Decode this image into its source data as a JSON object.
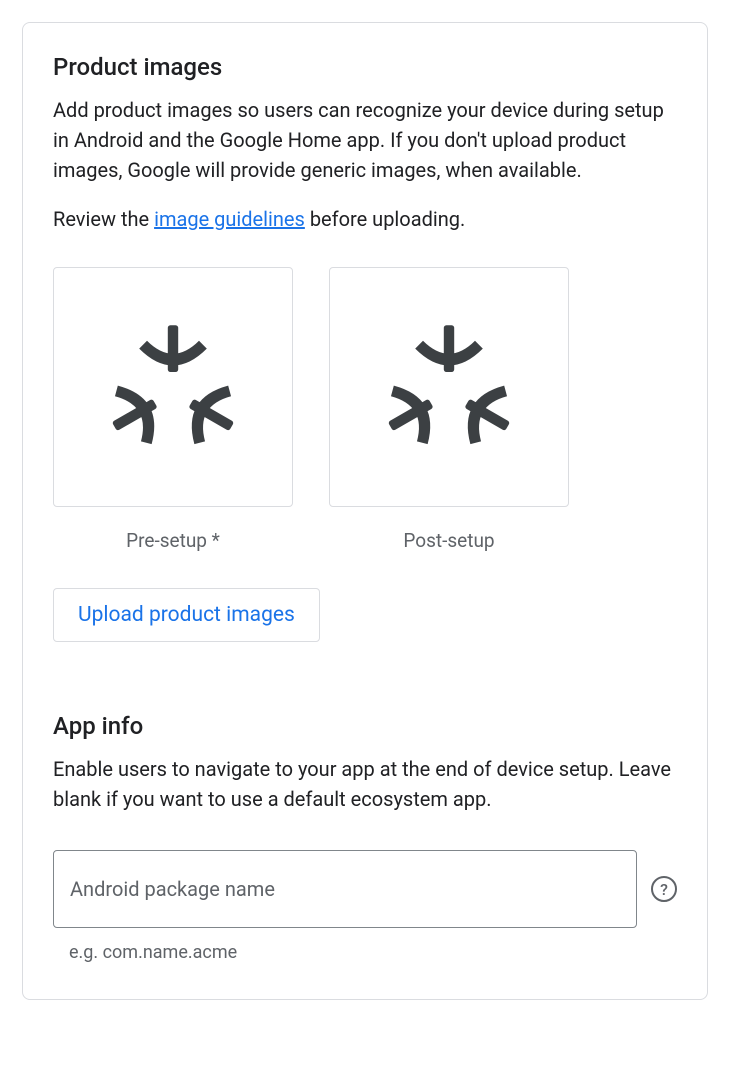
{
  "productImages": {
    "title": "Product images",
    "description": "Add product images so users can recognize your device during setup in Android and the Google Home app. If you don't upload product images, Google will provide generic images, when available.",
    "reviewPrefix": "Review the ",
    "reviewLink": "image guidelines",
    "reviewSuffix": " before uploading.",
    "items": [
      {
        "caption": "Pre-setup *"
      },
      {
        "caption": "Post-setup"
      }
    ],
    "uploadButton": "Upload product images"
  },
  "appInfo": {
    "title": "App info",
    "description": "Enable users to navigate to your app at the end of device setup. Leave blank if you want to use a default ecosystem app.",
    "packageName": {
      "placeholder": "Android package name",
      "value": "",
      "hint": "e.g. com.name.acme"
    }
  }
}
